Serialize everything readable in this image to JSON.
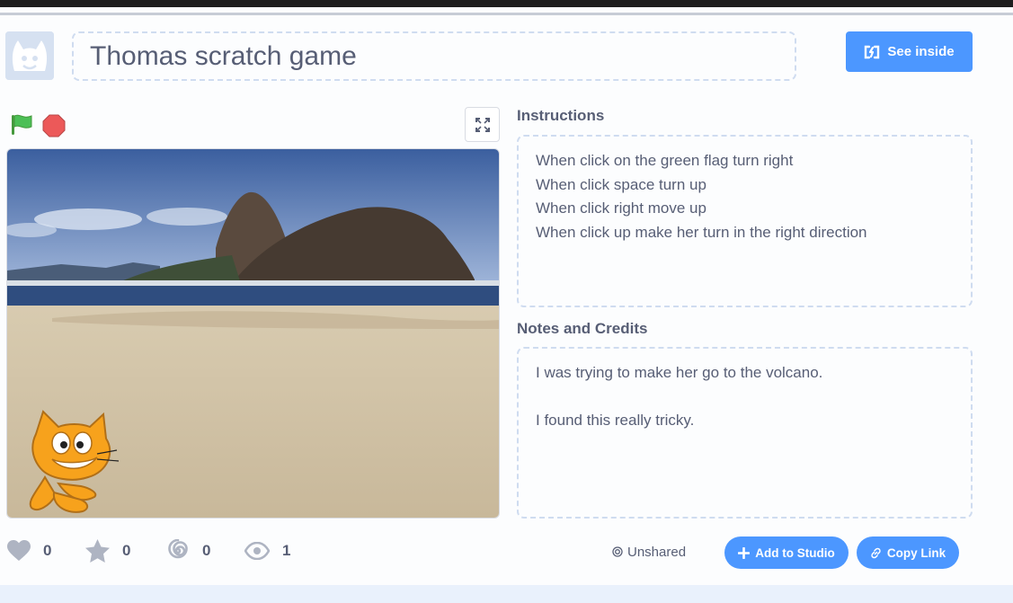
{
  "project": {
    "title": "Thomas scratch game",
    "see_inside_label": "See inside"
  },
  "sections": {
    "instructions_label": "Instructions",
    "instructions_lines": [
      "When click on the green flag turn right",
      "When click space turn up",
      "When click right move up",
      "When click up make her turn in the right direction"
    ],
    "notes_label": "Notes and Credits",
    "notes_lines": [
      "I was trying to make her go to the volcano.",
      "",
      "I found this really tricky."
    ]
  },
  "stats": {
    "loves": "0",
    "favorites": "0",
    "remixes": "0",
    "views": "1"
  },
  "sharing": {
    "status": "Unshared",
    "add_to_studio_label": "Add to Studio",
    "copy_link_label": "Copy Link"
  },
  "colors": {
    "accent": "#4c97ff",
    "text": "#575e75",
    "flag_green": "#4cbf56",
    "stop_red": "#ec5959"
  },
  "icons": {
    "green_flag": "green-flag-icon",
    "stop": "stop-icon",
    "fullscreen": "fullscreen-icon",
    "loves": "heart-icon",
    "favorites": "star-icon",
    "remixes": "remix-swirl-icon",
    "views": "eye-icon"
  }
}
